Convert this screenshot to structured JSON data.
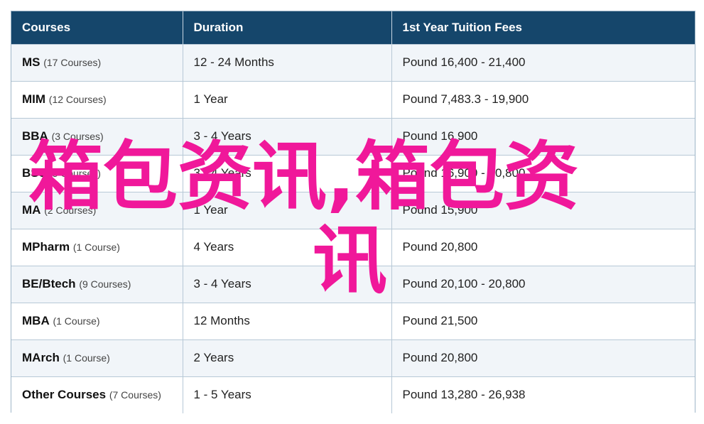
{
  "table": {
    "headers": [
      "Courses",
      "Duration",
      "1st Year Tuition Fees"
    ],
    "rows": [
      {
        "name": "MS",
        "count": "(17 Courses)",
        "duration": "12 - 24 Months",
        "fees": "Pound 16,400 - 21,400"
      },
      {
        "name": "MIM",
        "count": "(12 Courses)",
        "duration": "1 Year",
        "fees": "Pound 7,483.3 - 19,900"
      },
      {
        "name": "BBA",
        "count": "(3 Courses)",
        "duration": "3 - 4 Years",
        "fees": "Pound 16,900"
      },
      {
        "name": "BSc",
        "count": "(3 Courses)",
        "duration": "3 - 4 Years",
        "fees": "Pound 16,900 - 20,800"
      },
      {
        "name": "MA",
        "count": "(2 Courses)",
        "duration": "1 Year",
        "fees": "Pound 15,900"
      },
      {
        "name": "MPharm",
        "count": "(1 Course)",
        "duration": "4 Years",
        "fees": "Pound 20,800"
      },
      {
        "name": "BE/Btech",
        "count": "(9 Courses)",
        "duration": "3 - 4 Years",
        "fees": "Pound 20,100 - 20,800"
      },
      {
        "name": "MBA",
        "count": "(1 Course)",
        "duration": "12 Months",
        "fees": "Pound 21,500"
      },
      {
        "name": "MArch",
        "count": "(1 Course)",
        "duration": "2 Years",
        "fees": "Pound 20,800"
      },
      {
        "name": "Other Courses",
        "count": "(7 Courses)",
        "duration": "1 - 5 Years",
        "fees": "Pound 13,280 - 26,938"
      }
    ]
  },
  "watermark": {
    "line1": "箱包资讯,箱包资",
    "line2": "讯",
    "color": "#f0189a"
  },
  "colors": {
    "header_bg": "#15466b",
    "row_alt_bg": "#f1f5f9"
  }
}
